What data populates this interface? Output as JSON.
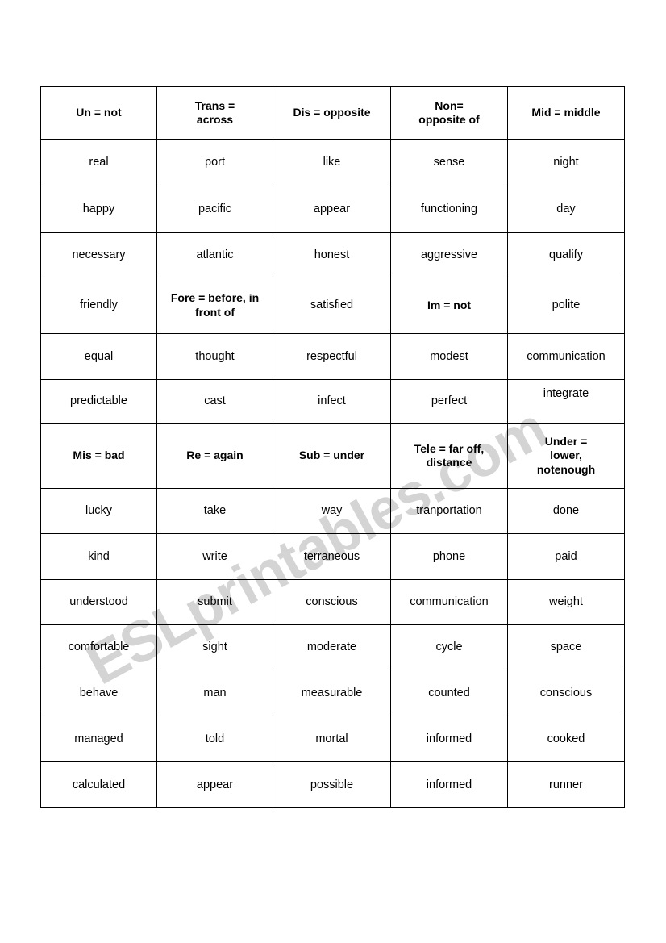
{
  "watermark": {
    "text": "ESLprintables.com",
    "color": "#d4d4d4"
  },
  "table": {
    "columns": 5,
    "rows": [
      {
        "type": "heading",
        "height": 65,
        "cells": [
          {
            "text": "Un = not",
            "bold": true
          },
          {
            "text": "Trans =\nacross",
            "bold": true
          },
          {
            "text": "Dis = opposite",
            "bold": true
          },
          {
            "text": "Non=\nopposite of",
            "bold": true
          },
          {
            "text": "Mid = middle",
            "bold": true
          }
        ]
      },
      {
        "type": "body",
        "height": 58,
        "cells": [
          {
            "text": "real",
            "bold": false
          },
          {
            "text": "port",
            "bold": false
          },
          {
            "text": "like",
            "bold": false
          },
          {
            "text": "sense",
            "bold": false
          },
          {
            "text": "night",
            "bold": false
          }
        ]
      },
      {
        "type": "body",
        "height": 58,
        "cells": [
          {
            "text": "happy",
            "bold": false
          },
          {
            "text": "pacific",
            "bold": false
          },
          {
            "text": "appear",
            "bold": false
          },
          {
            "text": "functioning",
            "bold": false
          },
          {
            "text": "day",
            "bold": false
          }
        ]
      },
      {
        "type": "body",
        "height": 55,
        "cells": [
          {
            "text": "necessary",
            "bold": false
          },
          {
            "text": "atlantic",
            "bold": false
          },
          {
            "text": "honest",
            "bold": false
          },
          {
            "text": "aggressive",
            "bold": false
          },
          {
            "text": "qualify",
            "bold": false
          }
        ]
      },
      {
        "type": "body",
        "height": 70,
        "cells": [
          {
            "text": "friendly",
            "bold": false
          },
          {
            "text": "Fore = before, in\nfront of",
            "bold": true
          },
          {
            "text": "satisfied",
            "bold": false
          },
          {
            "text": "Im = not",
            "bold": true
          },
          {
            "text": "polite",
            "bold": false
          }
        ]
      },
      {
        "type": "body",
        "height": 57,
        "cells": [
          {
            "text": "equal",
            "bold": false
          },
          {
            "text": "thought",
            "bold": false
          },
          {
            "text": "respectful",
            "bold": false
          },
          {
            "text": "modest",
            "bold": false
          },
          {
            "text": "communication",
            "bold": false
          }
        ]
      },
      {
        "type": "body",
        "height": 54,
        "cells": [
          {
            "text": "predictable",
            "bold": false
          },
          {
            "text": "cast",
            "bold": false
          },
          {
            "text": "infect",
            "bold": false
          },
          {
            "text": "perfect",
            "bold": false
          },
          {
            "text": "integrate",
            "bold": false,
            "align": "top"
          }
        ]
      },
      {
        "type": "heading",
        "height": 81,
        "cells": [
          {
            "text": "Mis = bad",
            "bold": true
          },
          {
            "text": "Re = again",
            "bold": true
          },
          {
            "text": "Sub = under",
            "bold": true
          },
          {
            "text": "Tele = far off,\ndistance",
            "bold": true
          },
          {
            "text": "Under =\nlower,\nnotenough",
            "bold": true
          }
        ]
      },
      {
        "type": "body",
        "height": 56,
        "cells": [
          {
            "text": "lucky",
            "bold": false
          },
          {
            "text": "take",
            "bold": false
          },
          {
            "text": "way",
            "bold": false
          },
          {
            "text": "tranportation",
            "bold": false
          },
          {
            "text": "done",
            "bold": false
          }
        ]
      },
      {
        "type": "body",
        "height": 57,
        "cells": [
          {
            "text": "kind",
            "bold": false
          },
          {
            "text": "write",
            "bold": false
          },
          {
            "text": "terraneous",
            "bold": false
          },
          {
            "text": "phone",
            "bold": false
          },
          {
            "text": "paid",
            "bold": false
          }
        ]
      },
      {
        "type": "body",
        "height": 56,
        "cells": [
          {
            "text": "understood",
            "bold": false
          },
          {
            "text": "submit",
            "bold": false
          },
          {
            "text": "conscious",
            "bold": false
          },
          {
            "text": "communication",
            "bold": false
          },
          {
            "text": "weight",
            "bold": false
          }
        ]
      },
      {
        "type": "body",
        "height": 56,
        "cells": [
          {
            "text": "comfortable",
            "bold": false
          },
          {
            "text": "sight",
            "bold": false
          },
          {
            "text": "moderate",
            "bold": false
          },
          {
            "text": "cycle",
            "bold": false
          },
          {
            "text": "space",
            "bold": false
          }
        ]
      },
      {
        "type": "body",
        "height": 57,
        "cells": [
          {
            "text": "behave",
            "bold": false
          },
          {
            "text": "man",
            "bold": false
          },
          {
            "text": "measurable",
            "bold": false
          },
          {
            "text": "counted",
            "bold": false
          },
          {
            "text": "conscious",
            "bold": false
          }
        ]
      },
      {
        "type": "body",
        "height": 57,
        "cells": [
          {
            "text": "managed",
            "bold": false
          },
          {
            "text": "told",
            "bold": false
          },
          {
            "text": "mortal",
            "bold": false
          },
          {
            "text": "informed",
            "bold": false
          },
          {
            "text": "cooked",
            "bold": false
          }
        ]
      },
      {
        "type": "body",
        "height": 57,
        "cells": [
          {
            "text": "calculated",
            "bold": false
          },
          {
            "text": "appear",
            "bold": false
          },
          {
            "text": "possible",
            "bold": false
          },
          {
            "text": "informed",
            "bold": false
          },
          {
            "text": "runner",
            "bold": false
          }
        ]
      }
    ]
  }
}
